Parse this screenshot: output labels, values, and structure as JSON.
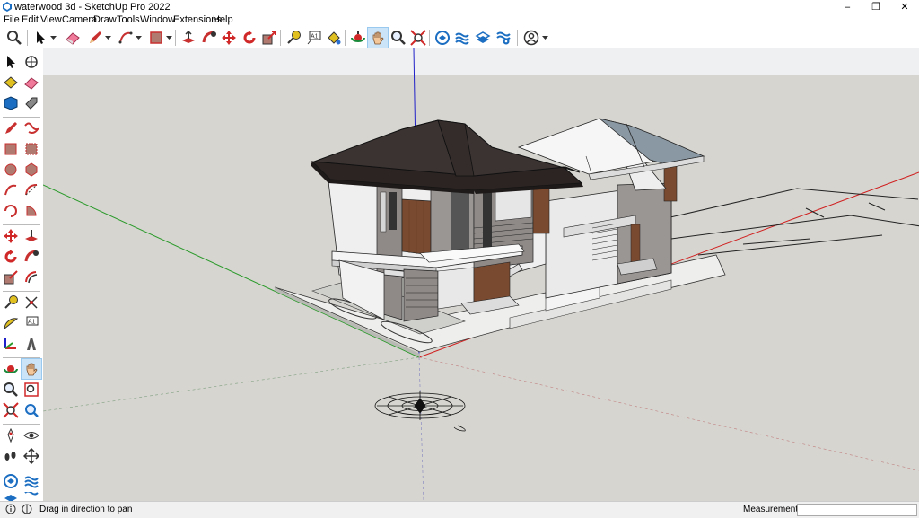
{
  "window": {
    "title": "waterwood 3d - SketchUp Pro 2022",
    "minimize_glyph": "–",
    "restore_glyph": "❐",
    "close_glyph": "✕"
  },
  "menu": [
    "File",
    "Edit",
    "View",
    "Camera",
    "Draw",
    "Tools",
    "Window",
    "Extensions",
    "Help"
  ],
  "toolbar_icons": [
    "zoom-icon",
    "select-icon",
    "eraser-icon",
    "pencil-icon",
    "arc-icon",
    "rectangle-icon",
    "push-pull-icon",
    "follow-me-icon",
    "move-icon",
    "rotate-icon",
    "scale-icon",
    "tape-measure-icon",
    "text-icon",
    "paint-bucket-icon",
    "orbit-icon",
    "pan-icon",
    "zoom-icon",
    "zoom-extents-icon",
    "3d-warehouse-icon",
    "extension-warehouse-icon",
    "layout-icon",
    "extension-manager-icon",
    "user-account-icon"
  ],
  "active_tool": "pan",
  "status": {
    "hint": "Drag in direction to pan",
    "measurements_label": "Measurements",
    "measurements_value": ""
  },
  "colors": {
    "sky": "#eef0f1",
    "ground": "#d6d5d0",
    "roof_front": "#3b3332",
    "roof_back": "#8a98a3",
    "wood": "#7a4a30",
    "wall_grey": "#8f8a88",
    "axis_red": "#d02020",
    "axis_green": "#2a9a2a",
    "axis_blue": "#2020c8",
    "active_tool_bg": "#cce4f7"
  }
}
